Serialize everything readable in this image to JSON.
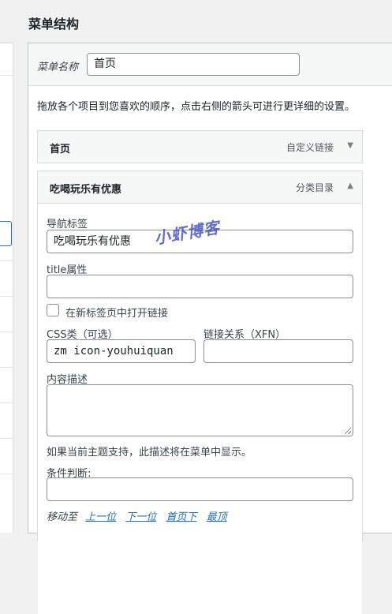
{
  "header": {
    "title": "菜单结构"
  },
  "menu_name": {
    "label": "菜单名称",
    "value": "首页"
  },
  "instruction": "拖放各个项目到您喜欢的顺序，点击右侧的箭头可进行更详细的设置。",
  "items": [
    {
      "title": "首页",
      "type": "自定义链接",
      "arrow": "▼",
      "expanded": false
    },
    {
      "title": "吃喝玩乐有优惠",
      "type": "分类目录",
      "arrow": "▲",
      "expanded": true
    }
  ],
  "item_settings": {
    "nav_label": {
      "label": "导航标签",
      "value": "吃喝玩乐有优惠"
    },
    "title_attr": {
      "label": "title属性",
      "value": ""
    },
    "new_tab": {
      "label": "在新标签页中打开链接",
      "checked": false
    },
    "css_classes": {
      "label": "CSS类（可选）",
      "value": "zm icon-youhuiquan"
    },
    "xfn": {
      "label": "链接关系（XFN）",
      "value": ""
    },
    "description": {
      "label": "内容描述",
      "value": "",
      "help": "如果当前主题支持，此描述将在菜单中显示。"
    },
    "condition": {
      "label": "条件判断:",
      "value": ""
    },
    "move": {
      "label": "移动至",
      "up": "上一位",
      "down": "下一位",
      "under_home": "首页下",
      "top": "最顶"
    }
  },
  "watermark": "小虾博客"
}
